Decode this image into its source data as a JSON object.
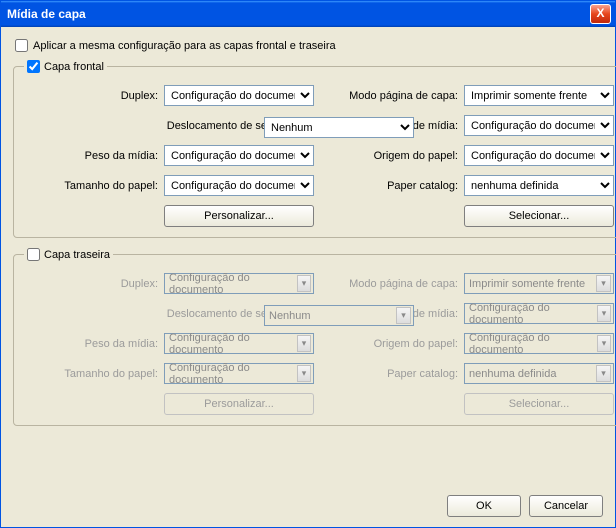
{
  "title": "Mídia de capa",
  "close_icon": "X",
  "apply_same_label": "Aplicar a mesma configuração para as capas frontal e traseira",
  "options": {
    "config_doc": "Configuração do documento",
    "nenhum": "Nenhum",
    "imprimir_frente": "Imprimir somente frente",
    "nenhuma_definida": "nenhuma definida"
  },
  "labels": {
    "duplex": "Duplex:",
    "desloc_sep": "Deslocamento de separador:",
    "peso_midia": "Peso da mídia:",
    "tamanho_papel": "Tamanho do papel:",
    "modo_pagina": "Modo página de capa:",
    "tipo_midia": "Tipo de mídia:",
    "origem_papel": "Origem do papel:",
    "paper_catalog": "Paper catalog:",
    "personalizar": "Personalizar...",
    "selecionar": "Selecionar..."
  },
  "front": {
    "legend": "Capa frontal",
    "checked": true
  },
  "back": {
    "legend": "Capa traseira",
    "checked": false
  },
  "footer": {
    "ok": "OK",
    "cancel": "Cancelar"
  }
}
